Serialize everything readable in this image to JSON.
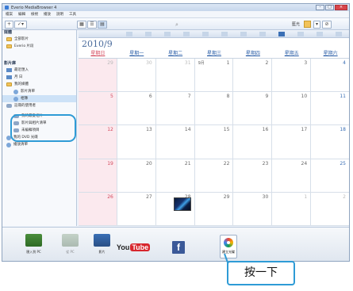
{
  "window": {
    "title": "Everio MediaBrowser 4",
    "controls": [
      "-",
      "□",
      "×"
    ]
  },
  "menu": [
    "檔案",
    "編輯",
    "檢視",
    "播放",
    "說明",
    "工具"
  ],
  "toolbar": {
    "add": "+",
    "tools": "✓▾",
    "right_label": "藍光"
  },
  "sidebar": {
    "library_head": "媒體",
    "library_items": [
      "全部影片",
      "Everio 片段"
    ],
    "section_head": "影片庫",
    "items": [
      "最近匯入",
      "月 日",
      "我的媒體",
      "影片清單",
      "相簿",
      "註冊的使用者"
    ],
    "more": [
      "我的最愛相片",
      "影片與相片清單",
      "未編輯項目",
      "我的 DVD 光碟",
      "播放清單"
    ],
    "selected_index": 3
  },
  "calendar": {
    "month": "2010/9",
    "weekdays": [
      "星期日",
      "星期一",
      "星期二",
      "星期三",
      "星期四",
      "星期五",
      "星期六"
    ],
    "weeks": [
      [
        "29",
        "30",
        "31",
        "1",
        "2",
        "3",
        "4"
      ],
      [
        "5",
        "6",
        "7",
        "8",
        "9",
        "10",
        "11"
      ],
      [
        "12",
        "13",
        "14",
        "15",
        "16",
        "17",
        "18"
      ],
      [
        "19",
        "20",
        "21",
        "22",
        "23",
        "24",
        "25"
      ],
      [
        "26",
        "27",
        "28",
        "29",
        "30",
        "1",
        "2"
      ]
    ],
    "first_week_extra": "9月",
    "thumbnail_day": "28"
  },
  "dock": {
    "buttons": [
      "匯入到 PC",
      "從 PC",
      "影片"
    ],
    "youtube": {
      "you": "You",
      "tube": "Tube"
    },
    "facebook": "f",
    "disc_label": "建立光碟"
  },
  "callout": "按一下"
}
